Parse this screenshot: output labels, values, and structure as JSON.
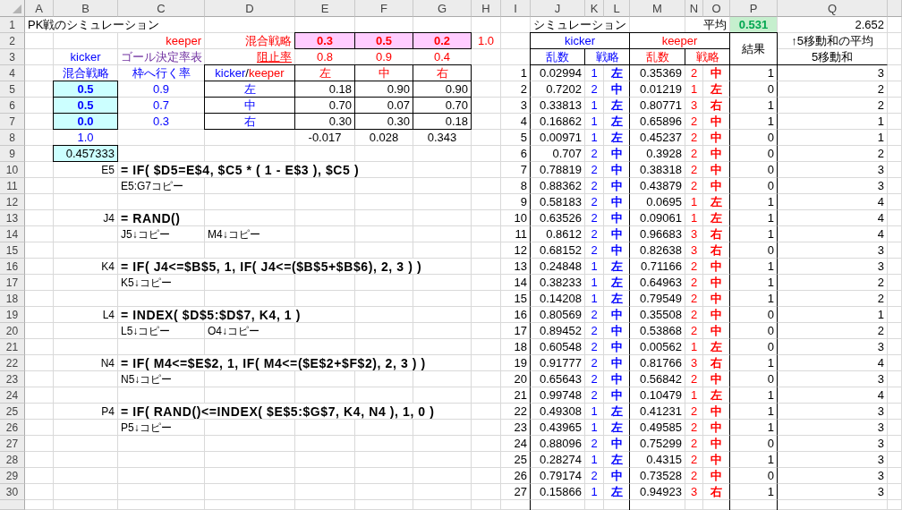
{
  "sheet": {
    "column_headers": [
      "A",
      "B",
      "C",
      "D",
      "E",
      "F",
      "G",
      "H",
      "I",
      "J",
      "K",
      "L",
      "M",
      "N",
      "O",
      "P",
      "Q"
    ],
    "row_numbers": [
      "1",
      "2",
      "3",
      "4",
      "5",
      "6",
      "7",
      "8",
      "9",
      "10",
      "11",
      "12",
      "13",
      "14",
      "15",
      "16",
      "17",
      "18",
      "19",
      "20",
      "21",
      "22",
      "23",
      "24",
      "25",
      "26",
      "27",
      "28",
      "29",
      "30"
    ]
  },
  "title": "PK戦のシミュレーション",
  "keeper": {
    "label": "keeper",
    "strategy_label": "混合戦略",
    "strategy": [
      "0.3",
      "0.5",
      "0.2"
    ],
    "strategy_sum": "1.0",
    "block_label": "阻止率",
    "block_rates": [
      "0.8",
      "0.9",
      "0.4"
    ]
  },
  "kicker": {
    "label": "kicker",
    "strategy_label": "混合戦略",
    "strategy": [
      "0.5",
      "0.5",
      "0.0"
    ],
    "strategy_sum": "1.0",
    "expected_goal_rate": "0.457333"
  },
  "goal_table": {
    "title": "ゴール決定率表",
    "on_target_label": "枠へ行く率",
    "on_target_rates": [
      "0.9",
      "0.7",
      "0.3"
    ],
    "corner": [
      {
        "text": "kicker",
        "kind": "kicker"
      },
      {
        "text": "/",
        "kind": "plain"
      },
      {
        "text": "keeper",
        "kind": "keeper"
      }
    ],
    "keeper_sides": [
      "左",
      "中",
      "右"
    ],
    "kicker_sides": [
      "左",
      "中",
      "右"
    ],
    "rates": [
      [
        "0.18",
        "0.90",
        "0.90"
      ],
      [
        "0.70",
        "0.07",
        "0.70"
      ],
      [
        "0.30",
        "0.30",
        "0.18"
      ]
    ],
    "column_results": [
      "-0.017",
      "0.028",
      "0.343"
    ]
  },
  "formulas": [
    {
      "cell": "E5",
      "formula": "= IF( $D5=E$4, $C5 * ( 1 - E$3 ), $C5 )",
      "notes": [
        "E5:G7コピー"
      ]
    },
    {
      "cell": "J4",
      "formula": "= RAND()",
      "notes": [
        "J5↓コピー",
        "M4↓コピー"
      ]
    },
    {
      "cell": "K4",
      "formula": "= IF( J4<=$B$5, 1, IF( J4<=($B$5+$B$6), 2, 3 ) )",
      "notes": [
        "K5↓コピー"
      ]
    },
    {
      "cell": "L4",
      "formula": "= INDEX( $D$5:$D$7, K4, 1 )",
      "notes": [
        "L5↓コピー",
        "O4↓コピー"
      ]
    },
    {
      "cell": "N4",
      "formula": "= IF( M4<=$E$2, 1, IF( M4<=($E$2+$F$2), 2, 3 ) )",
      "notes": [
        "N5↓コピー"
      ]
    },
    {
      "cell": "P4",
      "formula": "= IF( RAND()<=INDEX( $E$5:$G$7, K4, N4 ), 1, 0 )",
      "notes": [
        "P5↓コピー"
      ]
    }
  ],
  "simulation": {
    "title": "シミュレーション",
    "average_label": "平均",
    "average": "0.531",
    "moving_average": "2.652",
    "kicker_label": "kicker",
    "keeper_label": "keeper",
    "result_label": "結果",
    "moving_average_note": "↑5移動和の平均",
    "moving_sum_label": "5移動和",
    "kicker_columns": [
      "乱数",
      "戦略"
    ],
    "keeper_columns": [
      "乱数",
      "戦略"
    ],
    "rows": [
      {
        "no": "1",
        "kicker_random": "0.02994",
        "kicker_number": "1",
        "kicker_side": "左",
        "keeper_random": "0.35369",
        "keeper_number": "2",
        "keeper_side": "中",
        "result": "1",
        "moving_sum": "3"
      },
      {
        "no": "2",
        "kicker_random": "0.7202",
        "kicker_number": "2",
        "kicker_side": "中",
        "keeper_random": "0.01219",
        "keeper_number": "1",
        "keeper_side": "左",
        "result": "0",
        "moving_sum": "2"
      },
      {
        "no": "3",
        "kicker_random": "0.33813",
        "kicker_number": "1",
        "kicker_side": "左",
        "keeper_random": "0.80771",
        "keeper_number": "3",
        "keeper_side": "右",
        "result": "1",
        "moving_sum": "2"
      },
      {
        "no": "4",
        "kicker_random": "0.16862",
        "kicker_number": "1",
        "kicker_side": "左",
        "keeper_random": "0.65896",
        "keeper_number": "2",
        "keeper_side": "中",
        "result": "1",
        "moving_sum": "1"
      },
      {
        "no": "5",
        "kicker_random": "0.00971",
        "kicker_number": "1",
        "kicker_side": "左",
        "keeper_random": "0.45237",
        "keeper_number": "2",
        "keeper_side": "中",
        "result": "0",
        "moving_sum": "1"
      },
      {
        "no": "6",
        "kicker_random": "0.707",
        "kicker_number": "2",
        "kicker_side": "中",
        "keeper_random": "0.3928",
        "keeper_number": "2",
        "keeper_side": "中",
        "result": "0",
        "moving_sum": "2"
      },
      {
        "no": "7",
        "kicker_random": "0.78819",
        "kicker_number": "2",
        "kicker_side": "中",
        "keeper_random": "0.38318",
        "keeper_number": "2",
        "keeper_side": "中",
        "result": "0",
        "moving_sum": "3"
      },
      {
        "no": "8",
        "kicker_random": "0.88362",
        "kicker_number": "2",
        "kicker_side": "中",
        "keeper_random": "0.43879",
        "keeper_number": "2",
        "keeper_side": "中",
        "result": "0",
        "moving_sum": "3"
      },
      {
        "no": "9",
        "kicker_random": "0.58183",
        "kicker_number": "2",
        "kicker_side": "中",
        "keeper_random": "0.0695",
        "keeper_number": "1",
        "keeper_side": "左",
        "result": "1",
        "moving_sum": "4"
      },
      {
        "no": "10",
        "kicker_random": "0.63526",
        "kicker_number": "2",
        "kicker_side": "中",
        "keeper_random": "0.09061",
        "keeper_number": "1",
        "keeper_side": "左",
        "result": "1",
        "moving_sum": "4"
      },
      {
        "no": "11",
        "kicker_random": "0.8612",
        "kicker_number": "2",
        "kicker_side": "中",
        "keeper_random": "0.96683",
        "keeper_number": "3",
        "keeper_side": "右",
        "result": "1",
        "moving_sum": "4"
      },
      {
        "no": "12",
        "kicker_random": "0.68152",
        "kicker_number": "2",
        "kicker_side": "中",
        "keeper_random": "0.82638",
        "keeper_number": "3",
        "keeper_side": "右",
        "result": "0",
        "moving_sum": "3"
      },
      {
        "no": "13",
        "kicker_random": "0.24848",
        "kicker_number": "1",
        "kicker_side": "左",
        "keeper_random": "0.71166",
        "keeper_number": "2",
        "keeper_side": "中",
        "result": "1",
        "moving_sum": "3"
      },
      {
        "no": "14",
        "kicker_random": "0.38233",
        "kicker_number": "1",
        "kicker_side": "左",
        "keeper_random": "0.64963",
        "keeper_number": "2",
        "keeper_side": "中",
        "result": "1",
        "moving_sum": "2"
      },
      {
        "no": "15",
        "kicker_random": "0.14208",
        "kicker_number": "1",
        "kicker_side": "左",
        "keeper_random": "0.79549",
        "keeper_number": "2",
        "keeper_side": "中",
        "result": "1",
        "moving_sum": "2"
      },
      {
        "no": "16",
        "kicker_random": "0.80569",
        "kicker_number": "2",
        "kicker_side": "中",
        "keeper_random": "0.35508",
        "keeper_number": "2",
        "keeper_side": "中",
        "result": "0",
        "moving_sum": "1"
      },
      {
        "no": "17",
        "kicker_random": "0.89452",
        "kicker_number": "2",
        "kicker_side": "中",
        "keeper_random": "0.53868",
        "keeper_number": "2",
        "keeper_side": "中",
        "result": "0",
        "moving_sum": "2"
      },
      {
        "no": "18",
        "kicker_random": "0.60548",
        "kicker_number": "2",
        "kicker_side": "中",
        "keeper_random": "0.00562",
        "keeper_number": "1",
        "keeper_side": "左",
        "result": "0",
        "moving_sum": "3"
      },
      {
        "no": "19",
        "kicker_random": "0.91777",
        "kicker_number": "2",
        "kicker_side": "中",
        "keeper_random": "0.81766",
        "keeper_number": "3",
        "keeper_side": "右",
        "result": "1",
        "moving_sum": "4"
      },
      {
        "no": "20",
        "kicker_random": "0.65643",
        "kicker_number": "2",
        "kicker_side": "中",
        "keeper_random": "0.56842",
        "keeper_number": "2",
        "keeper_side": "中",
        "result": "0",
        "moving_sum": "3"
      },
      {
        "no": "21",
        "kicker_random": "0.99748",
        "kicker_number": "2",
        "kicker_side": "中",
        "keeper_random": "0.10479",
        "keeper_number": "1",
        "keeper_side": "左",
        "result": "1",
        "moving_sum": "4"
      },
      {
        "no": "22",
        "kicker_random": "0.49308",
        "kicker_number": "1",
        "kicker_side": "左",
        "keeper_random": "0.41231",
        "keeper_number": "2",
        "keeper_side": "中",
        "result": "1",
        "moving_sum": "3"
      },
      {
        "no": "23",
        "kicker_random": "0.43965",
        "kicker_number": "1",
        "kicker_side": "左",
        "keeper_random": "0.49585",
        "keeper_number": "2",
        "keeper_side": "中",
        "result": "1",
        "moving_sum": "3"
      },
      {
        "no": "24",
        "kicker_random": "0.88096",
        "kicker_number": "2",
        "kicker_side": "中",
        "keeper_random": "0.75299",
        "keeper_number": "2",
        "keeper_side": "中",
        "result": "0",
        "moving_sum": "3"
      },
      {
        "no": "25",
        "kicker_random": "0.28274",
        "kicker_number": "1",
        "kicker_side": "左",
        "keeper_random": "0.4315",
        "keeper_number": "2",
        "keeper_side": "中",
        "result": "1",
        "moving_sum": "3"
      },
      {
        "no": "26",
        "kicker_random": "0.79174",
        "kicker_number": "2",
        "kicker_side": "中",
        "keeper_random": "0.73528",
        "keeper_number": "2",
        "keeper_side": "中",
        "result": "0",
        "moving_sum": "3"
      },
      {
        "no": "27",
        "kicker_random": "0.15866",
        "kicker_number": "1",
        "kicker_side": "左",
        "keeper_random": "0.94923",
        "keeper_number": "3",
        "keeper_side": "右",
        "result": "1",
        "moving_sum": "3"
      }
    ]
  }
}
